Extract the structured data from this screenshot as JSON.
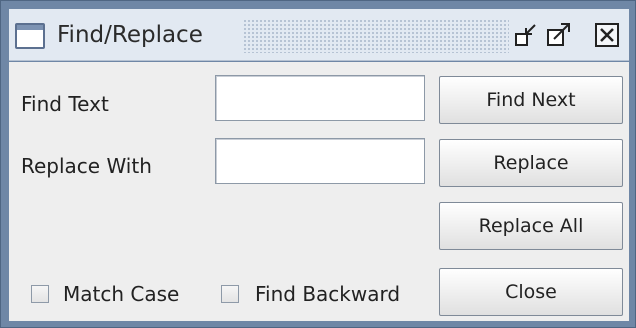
{
  "window": {
    "title": "Find/Replace",
    "controls": {
      "minimize_icon": "minimize-icon",
      "maximize_icon": "maximize-icon",
      "close_icon": "close-icon"
    }
  },
  "form": {
    "find_label": "Find Text",
    "find_value": "",
    "replace_label": "Replace With",
    "replace_value": ""
  },
  "buttons": {
    "find_next": "Find Next",
    "replace": "Replace",
    "replace_all": "Replace All",
    "close": "Close"
  },
  "options": [
    {
      "label": "Match Case",
      "checked": false
    },
    {
      "label": "Find Backward",
      "checked": false
    }
  ],
  "colors": {
    "frame": "#6f87a6",
    "titlebar": "#e2e9f2",
    "panel": "#eeeeee"
  }
}
